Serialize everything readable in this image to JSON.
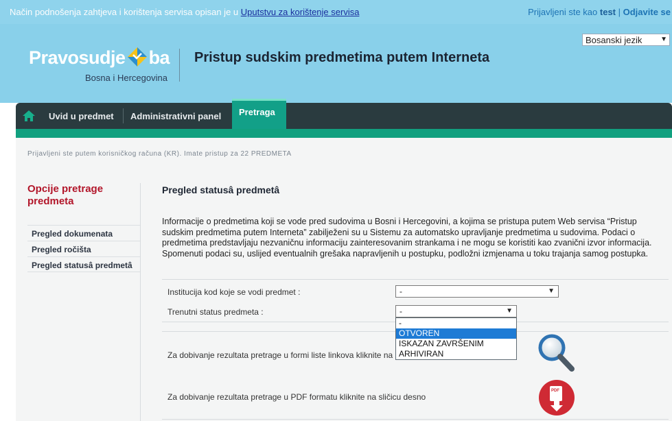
{
  "topbar": {
    "notice_text": "Način podnošenja zahtjeva i korištenja servisa opisan je u ",
    "manual_link": "Uputstvu za korištenje servisa",
    "logged_as": "Prijavljeni ste kao ",
    "username": "test",
    "separator": " | ",
    "logout": "Odjavite se"
  },
  "header": {
    "language": "Bosanski jezik",
    "logo_word_left": "Pravosudje",
    "logo_word_right": "ba",
    "logo_sub": "Bosna i Hercegovina",
    "site_title": "Pristup sudskim predmetima putem Interneta"
  },
  "nav": {
    "items": [
      "Uvid u predmet",
      "Administrativni panel"
    ],
    "active": "Pretraga"
  },
  "login_info": "Prijavljeni ste putem korisničkog računa (KR). Imate pristup za 22 PREDMETA",
  "sidebar": {
    "title": "Opcije pretrage predmeta",
    "items": [
      "Pregled dokumenata",
      "Pregled ročišta",
      "Pregled statusâ predmetâ"
    ]
  },
  "main": {
    "title": "Pregled statusâ predmetâ",
    "intro": "Informacije o predmetima koji se vode pred sudovima u Bosni i Hercegovini, a kojima se pristupa putem Web servisa “Pristup sudskim predmetima putem Interneta” zabilježeni su u Sistemu za automatsko upravljanje predmetima u sudovima. Podaci o predmetima predstavljaju nezvaničnu informaciju zainteresovanim strankama i ne mogu se koristiti kao zvanični izvor informacija. Spomenuti podaci su, uslijed eventualnih grešaka napravljenih u postupku, podložni izmjenama u toku trajanja samog postupka.",
    "institution_label": "Institucija kod koje se vodi predmet :",
    "institution_value": "-",
    "status_label": "Trenutni status predmeta :",
    "status_value": "-",
    "status_options": [
      "-",
      "OTVOREN",
      "ISKAZAN ZAVRŠENIM",
      "ARHIVIRAN"
    ],
    "status_highlighted": "OTVOREN",
    "links_result_text": "Za dobivanje rezultata pretrage u formi liste linkova kliknite na sličicu desno",
    "pdf_result_text": "Za dobivanje rezultata pretrage u PDF formatu kliknite na sličicu desno",
    "pdf_icon_label": "PDF"
  },
  "colors": {
    "topbar": "#8fd3ec",
    "header": "#89d0ea",
    "nav": "#2a3b3f",
    "accent_green": "#11a07f",
    "sidebar_title": "#b2162a",
    "highlight": "#1e7bd5"
  }
}
